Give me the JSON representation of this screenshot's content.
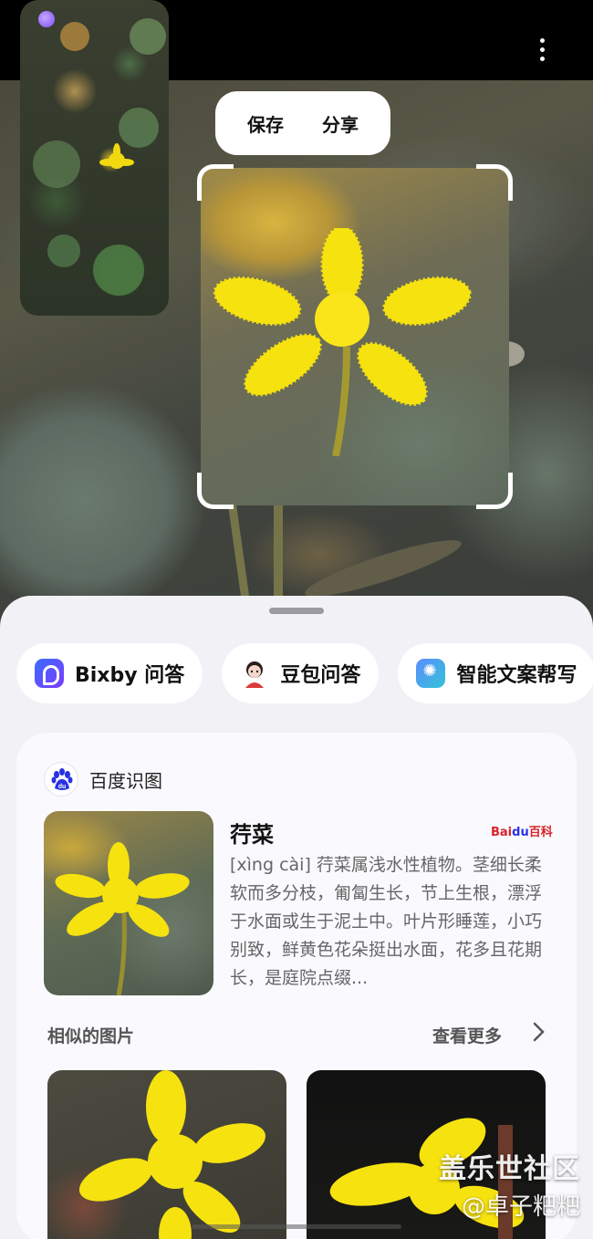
{
  "actions": {
    "save": "保存",
    "share": "分享"
  },
  "chips": [
    {
      "label": "Bixby 问答",
      "icon": "bixby-icon"
    },
    {
      "label": "豆包问答",
      "icon": "doubao-avatar-icon"
    },
    {
      "label": "智能文案帮写",
      "icon": "smart-writing-icon"
    }
  ],
  "result": {
    "source": "百度识图",
    "title": "荇菜",
    "badge_bai": "Bai",
    "badge_du": "du",
    "badge_baike": "百科",
    "description": "[xìng cài] 荇菜属浅水性植物。茎细长柔软而多分枝，匍匐生长，节上生根，漂浮于水面或生于泥土中。叶片形睡莲，小巧别致，鲜黄色花朵挺出水面，花多且花期长，是庭院点缀..."
  },
  "similar": {
    "label": "相似的图片",
    "more": "查看更多"
  },
  "watermark": {
    "line1": "盖乐世社区",
    "line2": "@卓子粑粑"
  },
  "colors": {
    "sheet": "#f1f1f6",
    "card": "#fafafe",
    "flower": "#f5e20e",
    "baidu": "#2932e1",
    "baidu_red": "#d8232a"
  }
}
